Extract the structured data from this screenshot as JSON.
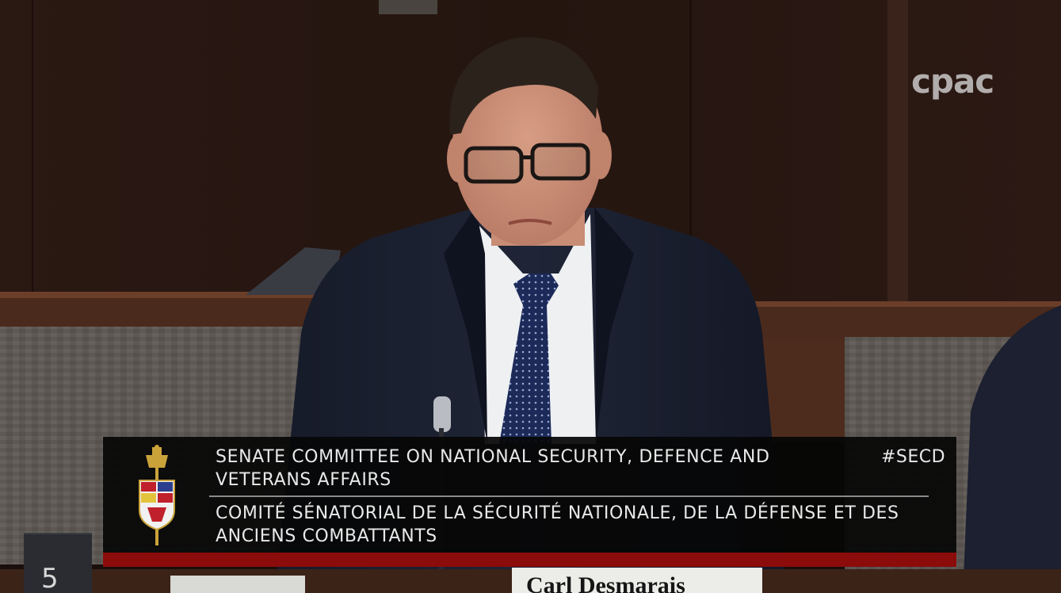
{
  "watermark": "cpac",
  "banner": {
    "title_en": "SENATE COMMITTEE ON NATIONAL SECURITY, DEFENCE AND VETERANS AFFAIRS",
    "title_fr": "COMITÉ SÉNATORIAL DE LA SÉCURITÉ NATIONALE, DE LA DÉFENSE ET DES ANCIENS COMBATTANTS",
    "hashtag": "#SECD",
    "accent_color": "#8c0b0b"
  },
  "seat_number": "5",
  "nameplate": "Carl Desmarais",
  "icons": [
    "senate-crest-icon",
    "microphone-icon"
  ]
}
